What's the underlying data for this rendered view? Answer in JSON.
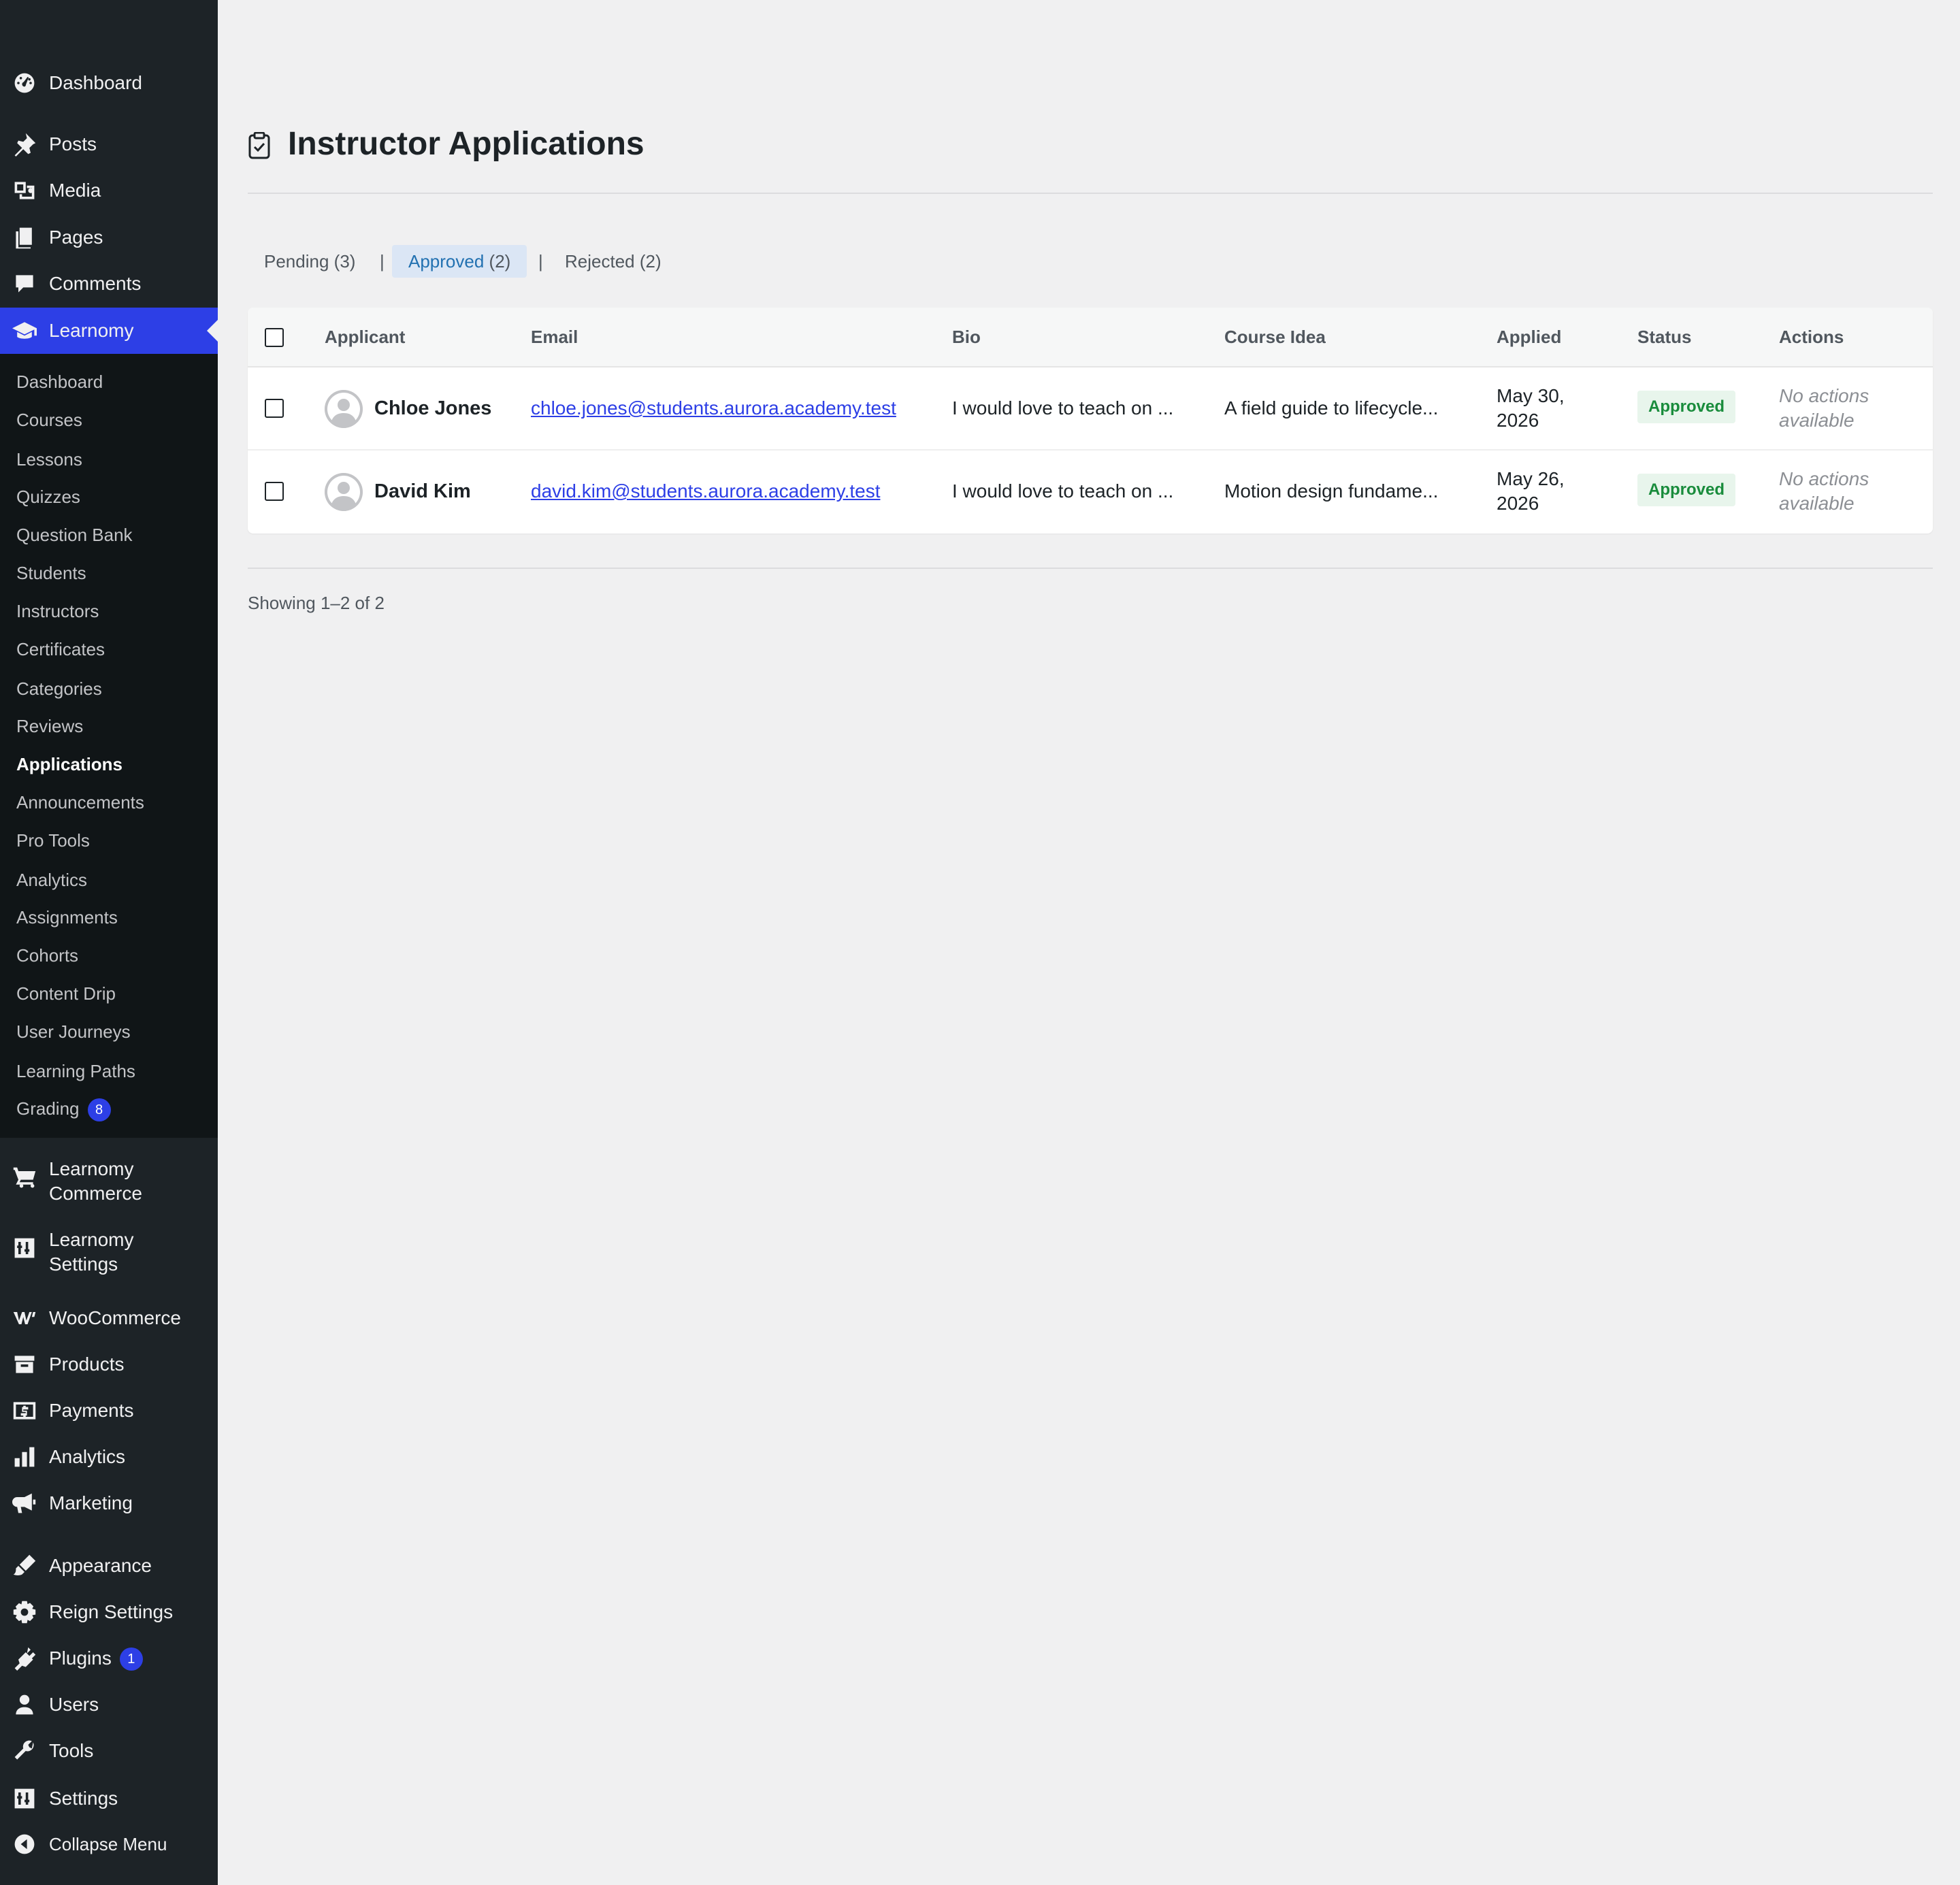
{
  "sidebar": {
    "items": [
      {
        "label": "Dashboard",
        "icon": "dashboard-icon"
      },
      {
        "label": "Posts",
        "icon": "pin-icon"
      },
      {
        "label": "Media",
        "icon": "media-icon"
      },
      {
        "label": "Pages",
        "icon": "pages-icon"
      },
      {
        "label": "Comments",
        "icon": "comment-icon"
      },
      {
        "label": "Learnomy",
        "icon": "graduation-cap-icon",
        "current": true
      },
      {
        "label": "Learnomy Commerce",
        "icon": "cart-icon"
      },
      {
        "label": "Learnomy Settings",
        "icon": "settings-sliders-icon"
      },
      {
        "label": "WooCommerce",
        "icon": "woocommerce-icon"
      },
      {
        "label": "Products",
        "icon": "archive-icon"
      },
      {
        "label": "Payments",
        "icon": "payments-icon"
      },
      {
        "label": "Analytics",
        "icon": "bar-chart-icon"
      },
      {
        "label": "Marketing",
        "icon": "megaphone-icon"
      },
      {
        "label": "Appearance",
        "icon": "brush-icon"
      },
      {
        "label": "Reign Settings",
        "icon": "gear-icon"
      },
      {
        "label": "Plugins",
        "icon": "plugin-icon",
        "badge": "1"
      },
      {
        "label": "Users",
        "icon": "user-icon"
      },
      {
        "label": "Tools",
        "icon": "wrench-icon"
      },
      {
        "label": "Settings",
        "icon": "settings-sliders-icon"
      },
      {
        "label": "Collapse Menu",
        "icon": "collapse-icon"
      }
    ],
    "submenu": [
      {
        "label": "Dashboard"
      },
      {
        "label": "Courses"
      },
      {
        "label": "Lessons"
      },
      {
        "label": "Quizzes"
      },
      {
        "label": "Question Bank"
      },
      {
        "label": "Students"
      },
      {
        "label": "Instructors"
      },
      {
        "label": "Certificates"
      },
      {
        "label": "Categories"
      },
      {
        "label": "Reviews"
      },
      {
        "label": "Applications",
        "active": true
      },
      {
        "label": "Announcements"
      },
      {
        "label": "Pro Tools"
      },
      {
        "label": "Analytics"
      },
      {
        "label": "Assignments"
      },
      {
        "label": "Cohorts"
      },
      {
        "label": "Content Drip"
      },
      {
        "label": "User Journeys"
      },
      {
        "label": "Learning Paths"
      },
      {
        "label": "Grading",
        "badge": "8"
      }
    ]
  },
  "page": {
    "title": "Instructor Applications",
    "icon": "clipboard-check-icon"
  },
  "tabs": [
    {
      "label": "Pending",
      "count": "(3)"
    },
    {
      "label": "Approved",
      "count": "(2)",
      "active": true
    },
    {
      "label": "Rejected",
      "count": "(2)"
    }
  ],
  "tab_separator": "|",
  "table": {
    "headers": [
      "Applicant",
      "Email",
      "Bio",
      "Course Idea",
      "Applied",
      "Status",
      "Actions"
    ],
    "rows": [
      {
        "name": "Chloe Jones",
        "email": "chloe.jones@students.aurora.academy.test",
        "bio": "I would love to teach on ...",
        "course_idea": "A field guide to lifecycle...",
        "applied": "May 30, 2026",
        "status": "Approved",
        "actions": "No actions available"
      },
      {
        "name": "David Kim",
        "email": "david.kim@students.aurora.academy.test",
        "bio": "I would love to teach on ...",
        "course_idea": "Motion design fundame...",
        "applied": "May 26, 2026",
        "status": "Approved",
        "actions": "No actions available"
      }
    ]
  },
  "pagination": {
    "showing": "Showing 1–2 of 2"
  },
  "colors": {
    "sidebar_bg": "#1d2327",
    "submenu_bg": "#101517",
    "accent": "#2d3fe6",
    "status_approved": "#198c3c",
    "status_approved_bg": "#e8f5ec"
  }
}
